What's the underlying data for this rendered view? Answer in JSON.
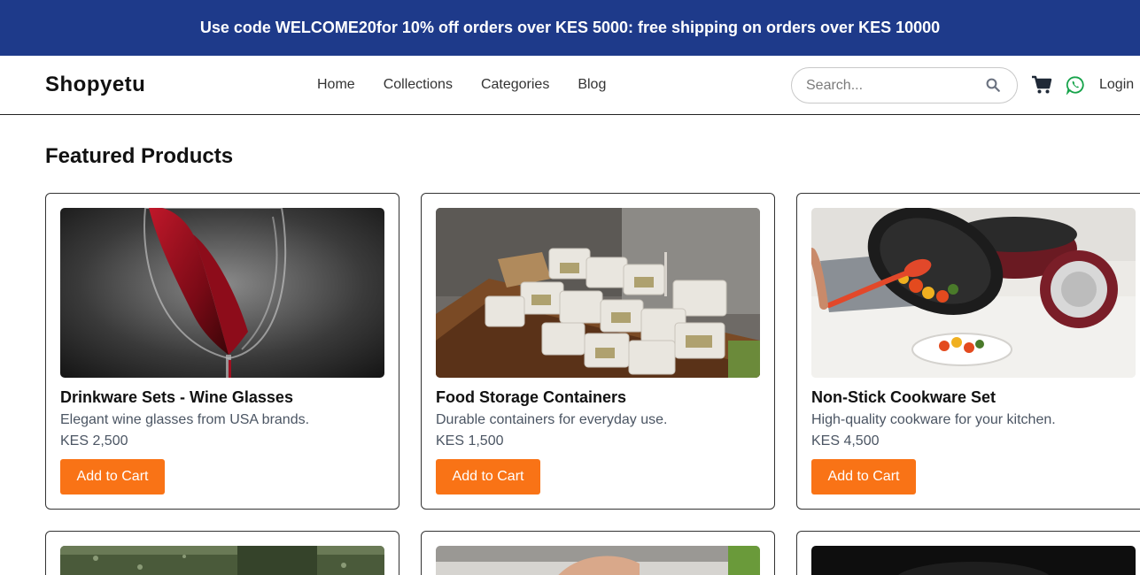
{
  "promo": {
    "prefix": "Use code ",
    "code": "WELCOME20",
    "suffix": "for 10% off orders over KES 5000: free shipping on orders over KES 10000"
  },
  "header": {
    "logo": "Shopyetu",
    "nav": [
      "Home",
      "Collections",
      "Categories",
      "Blog"
    ],
    "search_placeholder": "Search...",
    "login": "Login",
    "icons": [
      "search-icon",
      "cart-icon",
      "whatsapp-icon"
    ]
  },
  "main": {
    "section_title": "Featured Products",
    "products": [
      {
        "name": "Drinkware Sets - Wine Glasses",
        "description": "Elegant wine glasses from USA brands.",
        "price": "KES 2,500",
        "button": "Add to Cart"
      },
      {
        "name": "Food Storage Containers",
        "description": "Durable containers for everyday use.",
        "price": "KES 1,500",
        "button": "Add to Cart"
      },
      {
        "name": "Non-Stick Cookware Set",
        "description": "High-quality cookware for your kitchen.",
        "price": "KES 4,500",
        "button": "Add to Cart"
      }
    ]
  },
  "colors": {
    "promo_bg": "#1e3a8a",
    "button": "#f97316",
    "whatsapp": "#16a34a"
  }
}
